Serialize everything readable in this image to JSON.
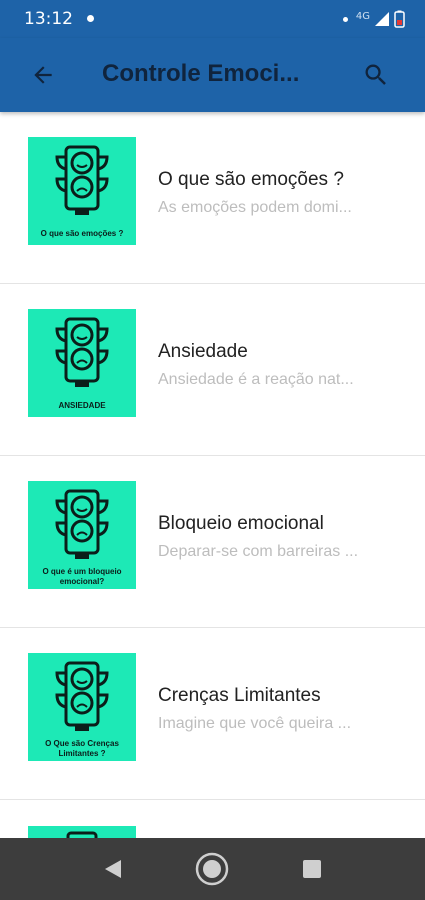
{
  "status_bar": {
    "time": "13:12",
    "network": "4G"
  },
  "app_bar": {
    "title": "Controle Emoci..."
  },
  "items": [
    {
      "title": "O que são emoções ?",
      "subtitle": "As emoções podem domi...",
      "thumb_caption": "O que são emoções ?"
    },
    {
      "title": "Ansiedade",
      "subtitle": "Ansiedade é a reação nat...",
      "thumb_caption": "ANSIEDADE"
    },
    {
      "title": "Bloqueio emocional",
      "subtitle": "Deparar-se com barreiras ...",
      "thumb_caption": "O que é um bloqueio emocional?"
    },
    {
      "title": "Crenças Limitantes",
      "subtitle": "Imagine que você queira ...",
      "thumb_caption": "O Que são Crenças Limitantes ?"
    }
  ],
  "colors": {
    "primary": "#1e63a8",
    "thumb_bg": "#1de9b6",
    "nav_bg": "#3d3d3d"
  }
}
